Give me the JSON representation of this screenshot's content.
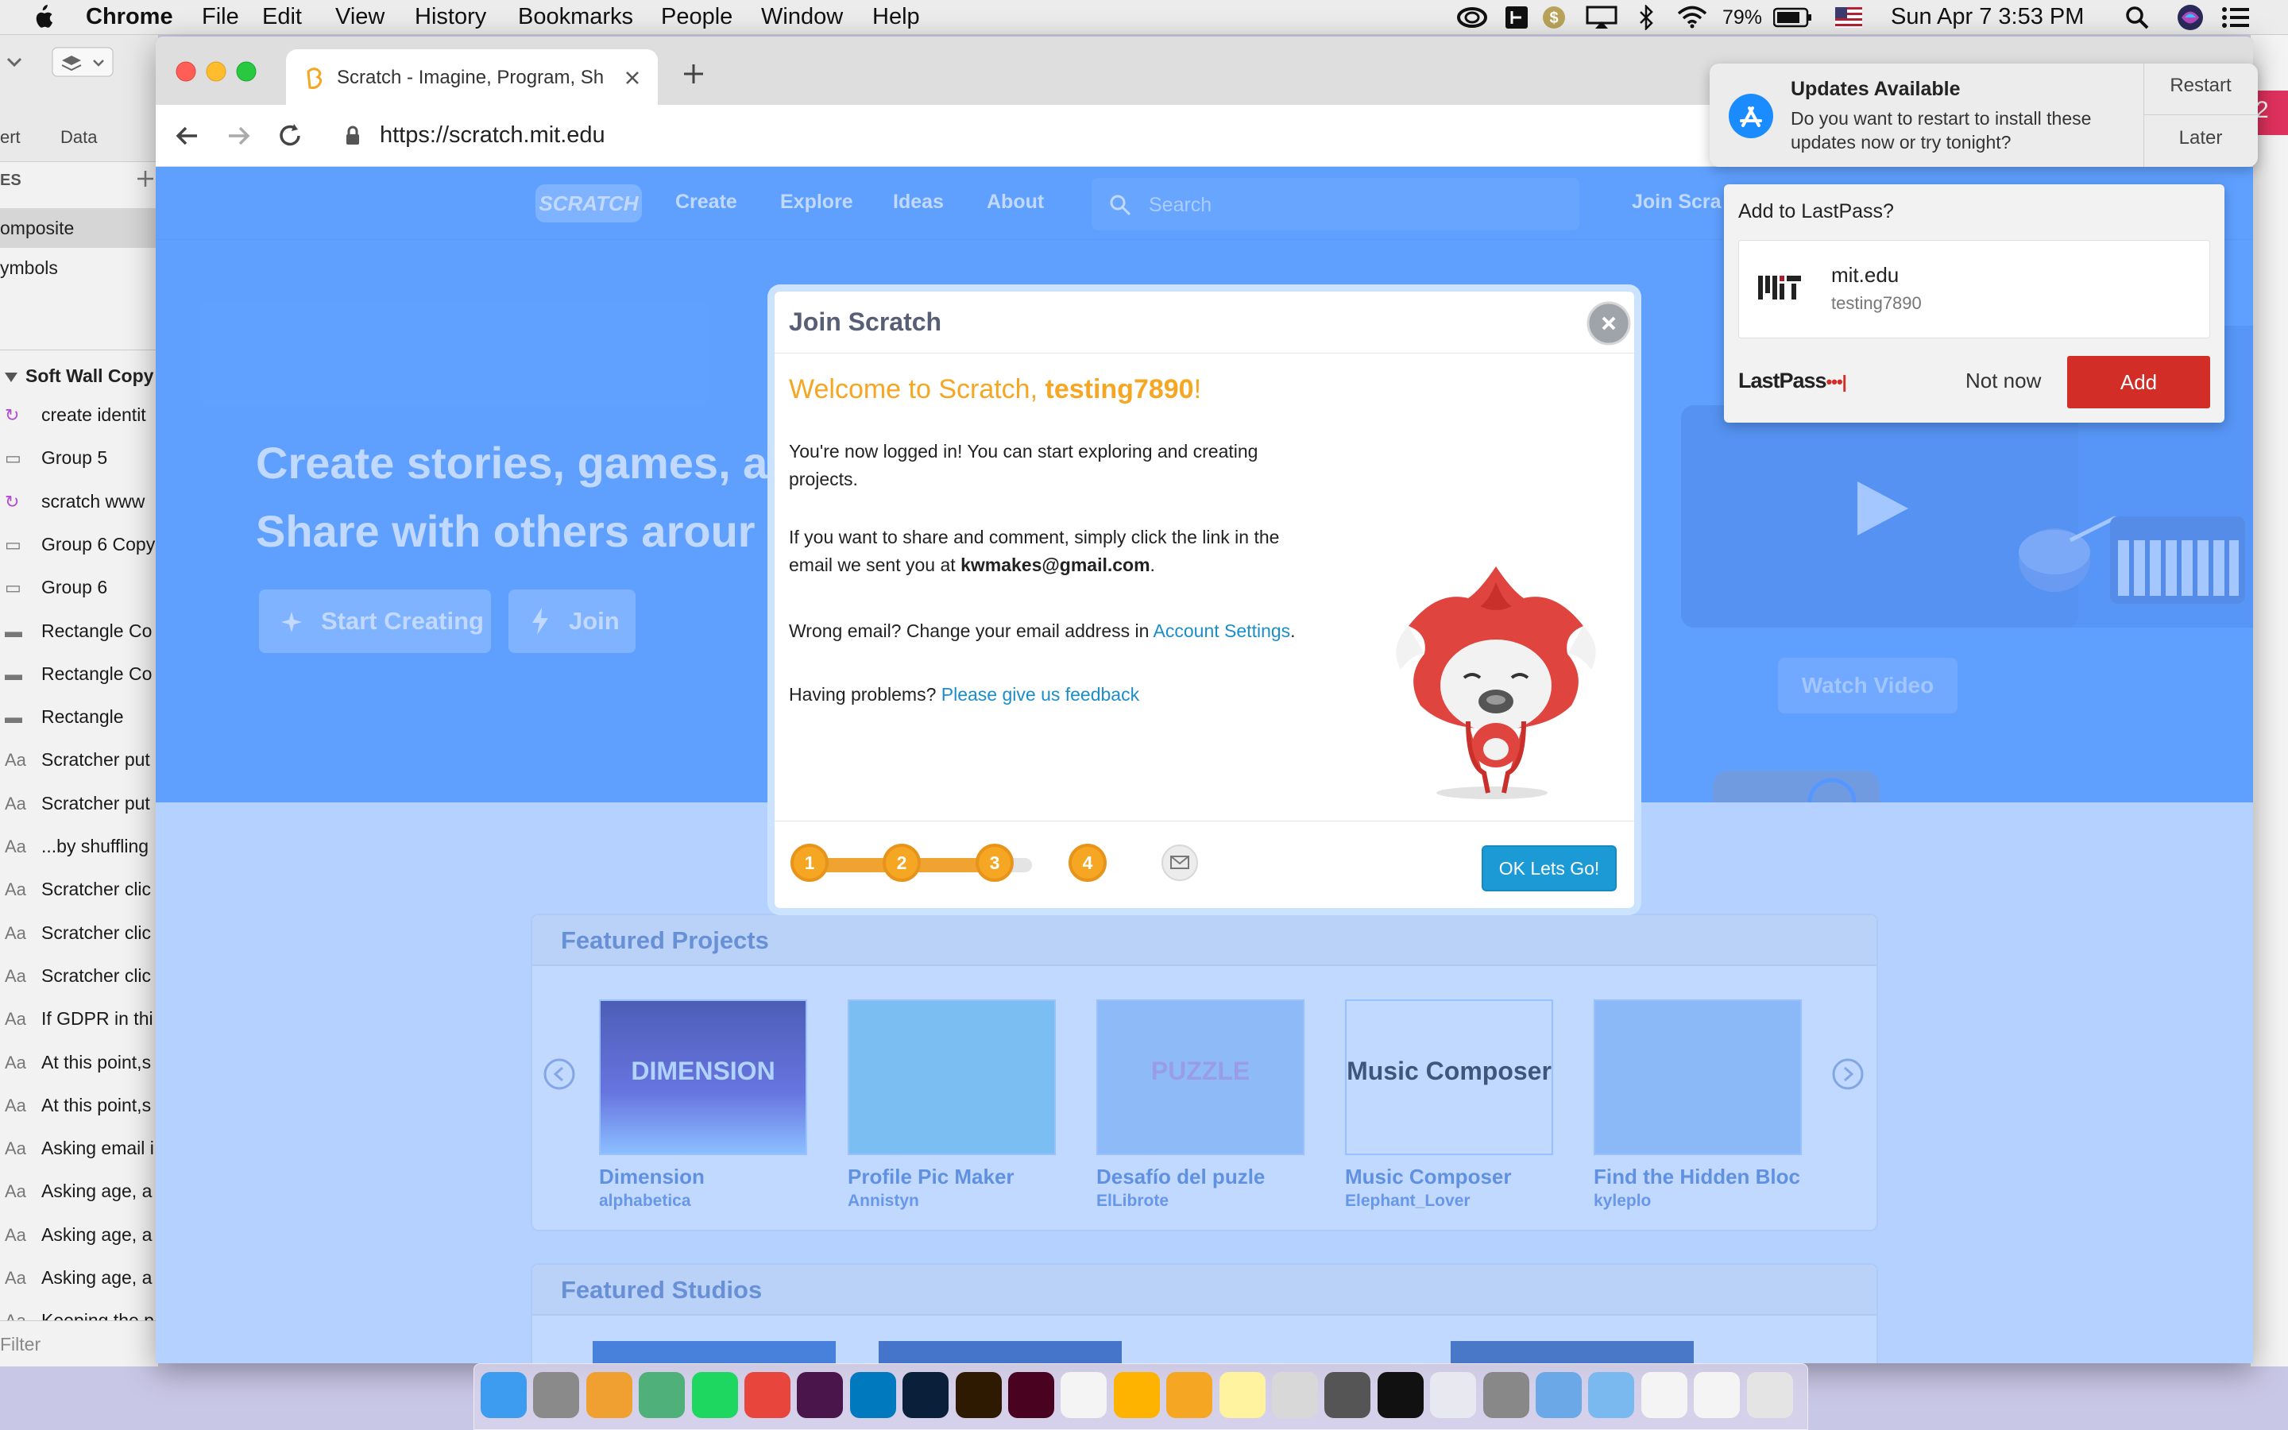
{
  "menubar": {
    "app": "Chrome",
    "items": [
      "File",
      "Edit",
      "View",
      "History",
      "Bookmarks",
      "People",
      "Window",
      "Help"
    ],
    "battery": "79%",
    "datetime": "Sun Apr 7  3:53 PM"
  },
  "bgapp": {
    "toolbar_labels": [
      "ert",
      "Data"
    ],
    "pages_header": "ES",
    "pages": [
      "omposite",
      "ymbols"
    ],
    "artboard": "Soft Wall Copy",
    "layers": [
      {
        "icon": "symbol-icon",
        "label": "create identit"
      },
      {
        "icon": "folder-icon",
        "label": "Group 5"
      },
      {
        "icon": "symbol-icon",
        "label": "scratch www"
      },
      {
        "icon": "folder-icon",
        "label": "Group 6 Copy"
      },
      {
        "icon": "folder-icon",
        "label": "Group 6"
      },
      {
        "icon": "rectangle-icon",
        "label": "Rectangle Co"
      },
      {
        "icon": "rectangle-icon",
        "label": "Rectangle Co"
      },
      {
        "icon": "rectangle-icon",
        "label": "Rectangle"
      },
      {
        "icon": "text-icon",
        "label": "Scratcher put"
      },
      {
        "icon": "text-icon",
        "label": "Scratcher put"
      },
      {
        "icon": "text-icon",
        "label": "...by shuffling"
      },
      {
        "icon": "text-icon",
        "label": "Scratcher clic"
      },
      {
        "icon": "text-icon",
        "label": "Scratcher clic"
      },
      {
        "icon": "text-icon",
        "label": "Scratcher clic"
      },
      {
        "icon": "text-icon",
        "label": "If GDPR in thi"
      },
      {
        "icon": "text-icon",
        "label": "At this point,s"
      },
      {
        "icon": "text-icon",
        "label": "At this point,s"
      },
      {
        "icon": "text-icon",
        "label": "Asking email i"
      },
      {
        "icon": "text-icon",
        "label": "Asking age, a"
      },
      {
        "icon": "text-icon",
        "label": "Asking age, a"
      },
      {
        "icon": "text-icon",
        "label": "Asking age, a"
      },
      {
        "icon": "text-icon",
        "label": "Keeping the p"
      },
      {
        "icon": "text-icon",
        "label": "Keeping the p"
      }
    ],
    "text_icon_glyph": "Aa",
    "filter": "Filter"
  },
  "chrome": {
    "tab_title": "Scratch - Imagine, Program, Sh",
    "url": "https://scratch.mit.edu"
  },
  "scratch": {
    "logo": "SCRATCH",
    "nav": [
      "Create",
      "Explore",
      "Ideas",
      "About"
    ],
    "search_placeholder": "Search",
    "join": "Join Scra",
    "hero_line1": "Create stories, games, a",
    "hero_line2": "Share with others arour",
    "start_creating": "Start Creating",
    "join_btn": "Join",
    "watch_video": "Watch Video",
    "featured_projects": "Featured Projects",
    "featured_studios": "Featured Studios",
    "projects": [
      {
        "title": "Dimension",
        "author": "alphabetica",
        "thumb_text": "DIMENSION"
      },
      {
        "title": "Profile Pic Maker",
        "author": "Annistyn",
        "thumb_text": ""
      },
      {
        "title": "Desafío del puzle",
        "author": "ElLibrote",
        "thumb_text": "PUZZLE"
      },
      {
        "title": "Music Composer",
        "author": "Elephant_Lover",
        "thumb_text": "Music Composer"
      },
      {
        "title": "Find the Hidden Bloc",
        "author": "kyleplo",
        "thumb_text": ""
      }
    ]
  },
  "modal": {
    "title": "Join Scratch",
    "welcome_prefix": "Welcome to Scratch, ",
    "username": "testing7890",
    "welcome_suffix": "!",
    "p1_line1": "You're now logged in! You can start exploring and creating",
    "p1_line2": "projects.",
    "p2_line1": "If you want to share and comment, simply click the link in the",
    "p2_line2_prefix": "email we sent you at ",
    "email": "kwmakes@gmail.com",
    "p2_line2_suffix": ".",
    "p3_prefix": "Wrong email? Change your email address in ",
    "p3_link": "Account Settings",
    "p3_suffix": ".",
    "p4_prefix": "Having problems? ",
    "p4_link": "Please give us feedback",
    "steps": [
      "1",
      "2",
      "3",
      "4"
    ],
    "ok_button": "OK Lets Go!"
  },
  "notification": {
    "title": "Updates Available",
    "body_line1": "Do you want to restart to install these",
    "body_line2": "updates now or try tonight?",
    "restart": "Restart",
    "later": "Later"
  },
  "lastpass": {
    "title": "Add to LastPass?",
    "site": "mit.edu",
    "username": "testing7890",
    "logo": "LastPass",
    "logo_dots": "•••|",
    "not_now": "Not now",
    "add": "Add"
  },
  "edge_badge": "2",
  "colors": {
    "scratch_blue": "#4c97ff",
    "accent_orange": "#f5a623",
    "ok_blue": "#1b9ad6",
    "lastpass_red": "#d32d27"
  }
}
